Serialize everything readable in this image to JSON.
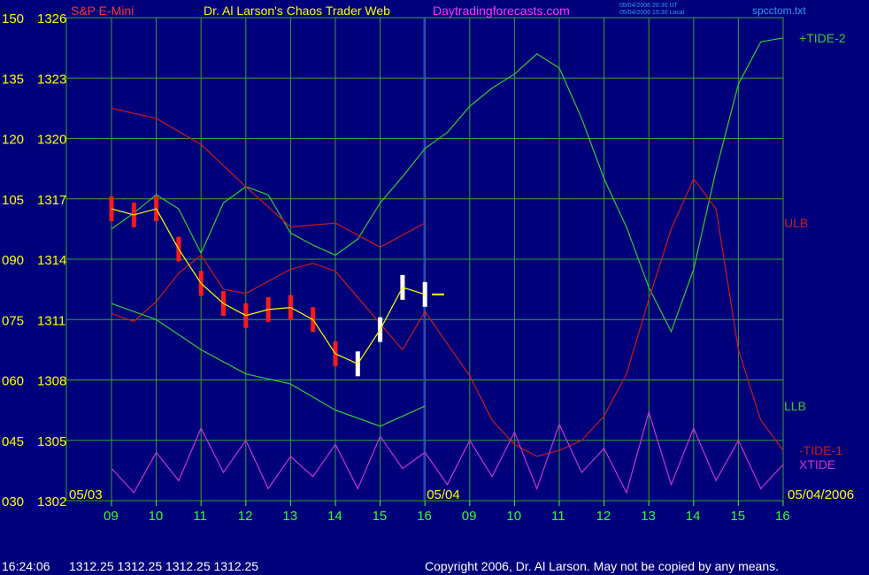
{
  "header": {
    "instrument": "S&P E-Mini",
    "site_title": "Dr. Al Larson's Chaos Trader Web",
    "site_url": "Daytradingforecasts.com",
    "timestamp_ut": "05/04/2006 20:30 UT",
    "timestamp_local": "05/04/2006 15:30 Local",
    "filename": "spcctom.txt"
  },
  "footer": {
    "time": "16:24:06",
    "quote": "1312.25 1312.25 1312.25 1312.25",
    "copyright": "Copyright 2006, Dr. Al Larson. May not be copied by any means."
  },
  "colors": {
    "background": "#00007a",
    "grid": "#2fa52f",
    "price_bars": "#ff1a1a",
    "price_bars_today": "#ffffff",
    "price_avg": "#ffff00",
    "ulb_llb_band": "#33cc33",
    "tide_red": "#cc1a1a",
    "tide_green": "#33cc33",
    "xtide": "#cc33cc",
    "time_labels": "#33ff33",
    "axis_labels": "#ffff00",
    "title": "#ffff00",
    "url": "#ff33ff",
    "instrument": "#ff3333",
    "filename": "#3399ff"
  },
  "chart_data": {
    "type": "line",
    "title": "Dr. Al Larson's Chaos Trader Web",
    "instrument": "S&P E-Mini",
    "y_axis_left": {
      "oscillator_ticks": [
        "150",
        "135",
        "120",
        "105",
        "090",
        "075",
        "060",
        "045",
        "030"
      ],
      "price_ticks": [
        "1326",
        "1323",
        "1320",
        "1317",
        "1314",
        "1311",
        "1308",
        "1305",
        "1302"
      ],
      "price_range": [
        1302,
        1326
      ],
      "oscillator_range": [
        30,
        150
      ]
    },
    "x_axis": {
      "date_labels": [
        "05/03",
        "05/04",
        "05/04/2006"
      ],
      "hour_ticks": [
        "09",
        "10",
        "11",
        "12",
        "13",
        "14",
        "15",
        "16",
        "09",
        "10",
        "11",
        "12",
        "13",
        "14",
        "15",
        "16"
      ],
      "sessions": [
        "05/03",
        "05/04"
      ]
    },
    "grid": true,
    "last_price": 1312.25,
    "series": [
      {
        "name": "+TIDE-2",
        "color": "green",
        "x": [
          9.0,
          9.5,
          10.0,
          10.5,
          11.0,
          11.5,
          12.0,
          12.5,
          13.0,
          13.5,
          14.0,
          14.5,
          15.0,
          15.5,
          16.0,
          16.5,
          17.0,
          17.5,
          18.0,
          18.5,
          19.0,
          19.5,
          20.0,
          20.5,
          21.0,
          21.5,
          22.0,
          22.5,
          23.0,
          23.5,
          24.0
        ],
        "y": [
          1315.5,
          1316.3,
          1317.2,
          1316.5,
          1314.3,
          1316.8,
          1317.6,
          1317.2,
          1315.3,
          1314.7,
          1314.2,
          1315.0,
          1316.8,
          1318.1,
          1319.5,
          1320.3,
          1321.6,
          1322.5,
          1323.2,
          1324.2,
          1323.5,
          1321.0,
          1318.0,
          1315.6,
          1312.6,
          1310.4,
          1313.5,
          1318.4,
          1322.7,
          1324.8,
          1325.0
        ]
      },
      {
        "name": "-TIDE-1",
        "color": "red",
        "x": [
          9.0,
          9.5,
          10.0,
          10.5,
          11.0,
          11.5,
          12.0,
          12.5,
          13.0,
          13.5,
          14.0,
          14.5,
          15.0,
          15.5,
          16.0,
          16.5,
          17.0,
          17.5,
          18.0,
          18.5,
          19.0,
          19.5,
          20.0,
          20.5,
          21.0,
          21.5,
          22.0,
          22.5,
          23.0,
          23.5,
          24.0
        ],
        "y": [
          1311.3,
          1310.9,
          1311.9,
          1313.3,
          1314.2,
          1312.5,
          1312.3,
          1312.9,
          1313.5,
          1313.8,
          1313.4,
          1312.1,
          1310.8,
          1309.5,
          1311.4,
          1309.8,
          1308.2,
          1306.0,
          1304.8,
          1304.2,
          1304.5,
          1305.0,
          1306.2,
          1308.3,
          1312.0,
          1315.5,
          1318.0,
          1316.5,
          1309.5,
          1306.0,
          1304.5
        ]
      },
      {
        "name": "ULB",
        "color": "red",
        "x": [
          9.0,
          10.0,
          11.0,
          12.0,
          13.0,
          14.0,
          15.0,
          16.0
        ],
        "y": [
          1321.5,
          1321.0,
          1319.7,
          1317.6,
          1315.6,
          1315.8,
          1314.6,
          1315.8
        ]
      },
      {
        "name": "LLB",
        "color": "green",
        "x": [
          9.0,
          10.0,
          11.0,
          12.0,
          13.0,
          14.0,
          15.0,
          16.0
        ],
        "y": [
          1311.8,
          1311.0,
          1309.5,
          1308.3,
          1307.8,
          1306.5,
          1305.7,
          1306.7
        ]
      },
      {
        "name": "XTIDE",
        "color": "magenta",
        "x": [
          9.0,
          9.5,
          10.0,
          10.5,
          11.0,
          11.5,
          12.0,
          12.5,
          13.0,
          13.5,
          14.0,
          14.5,
          15.0,
          15.5,
          16.0,
          16.5,
          17.0,
          17.5,
          18.0,
          18.5,
          19.0,
          19.5,
          20.0,
          20.5,
          21.0,
          21.5,
          22.0,
          22.5,
          23.0,
          23.5,
          24.0
        ],
        "y": [
          38.0,
          32.0,
          42.0,
          35.0,
          48.0,
          37.0,
          45.0,
          33.0,
          41.0,
          36.0,
          44.0,
          33.0,
          46.0,
          38.0,
          42.0,
          34.0,
          45.0,
          36.0,
          47.0,
          33.0,
          49.0,
          37.0,
          43.0,
          32.0,
          52.0,
          34.0,
          48.0,
          35.0,
          45.0,
          33.0,
          39.0
        ]
      },
      {
        "name": "price",
        "color": "red",
        "x": [
          9.0,
          9.5,
          10.0,
          10.5,
          11.0,
          11.5,
          12.0,
          12.5,
          13.0,
          13.5,
          14.0,
          14.5,
          15.0,
          15.5,
          16.0
        ],
        "y": [
          1316.5,
          1316.2,
          1316.5,
          1314.5,
          1312.8,
          1311.8,
          1311.2,
          1311.5,
          1311.6,
          1311.0,
          1309.3,
          1308.8,
          1310.5,
          1312.6,
          1312.25
        ]
      }
    ]
  }
}
